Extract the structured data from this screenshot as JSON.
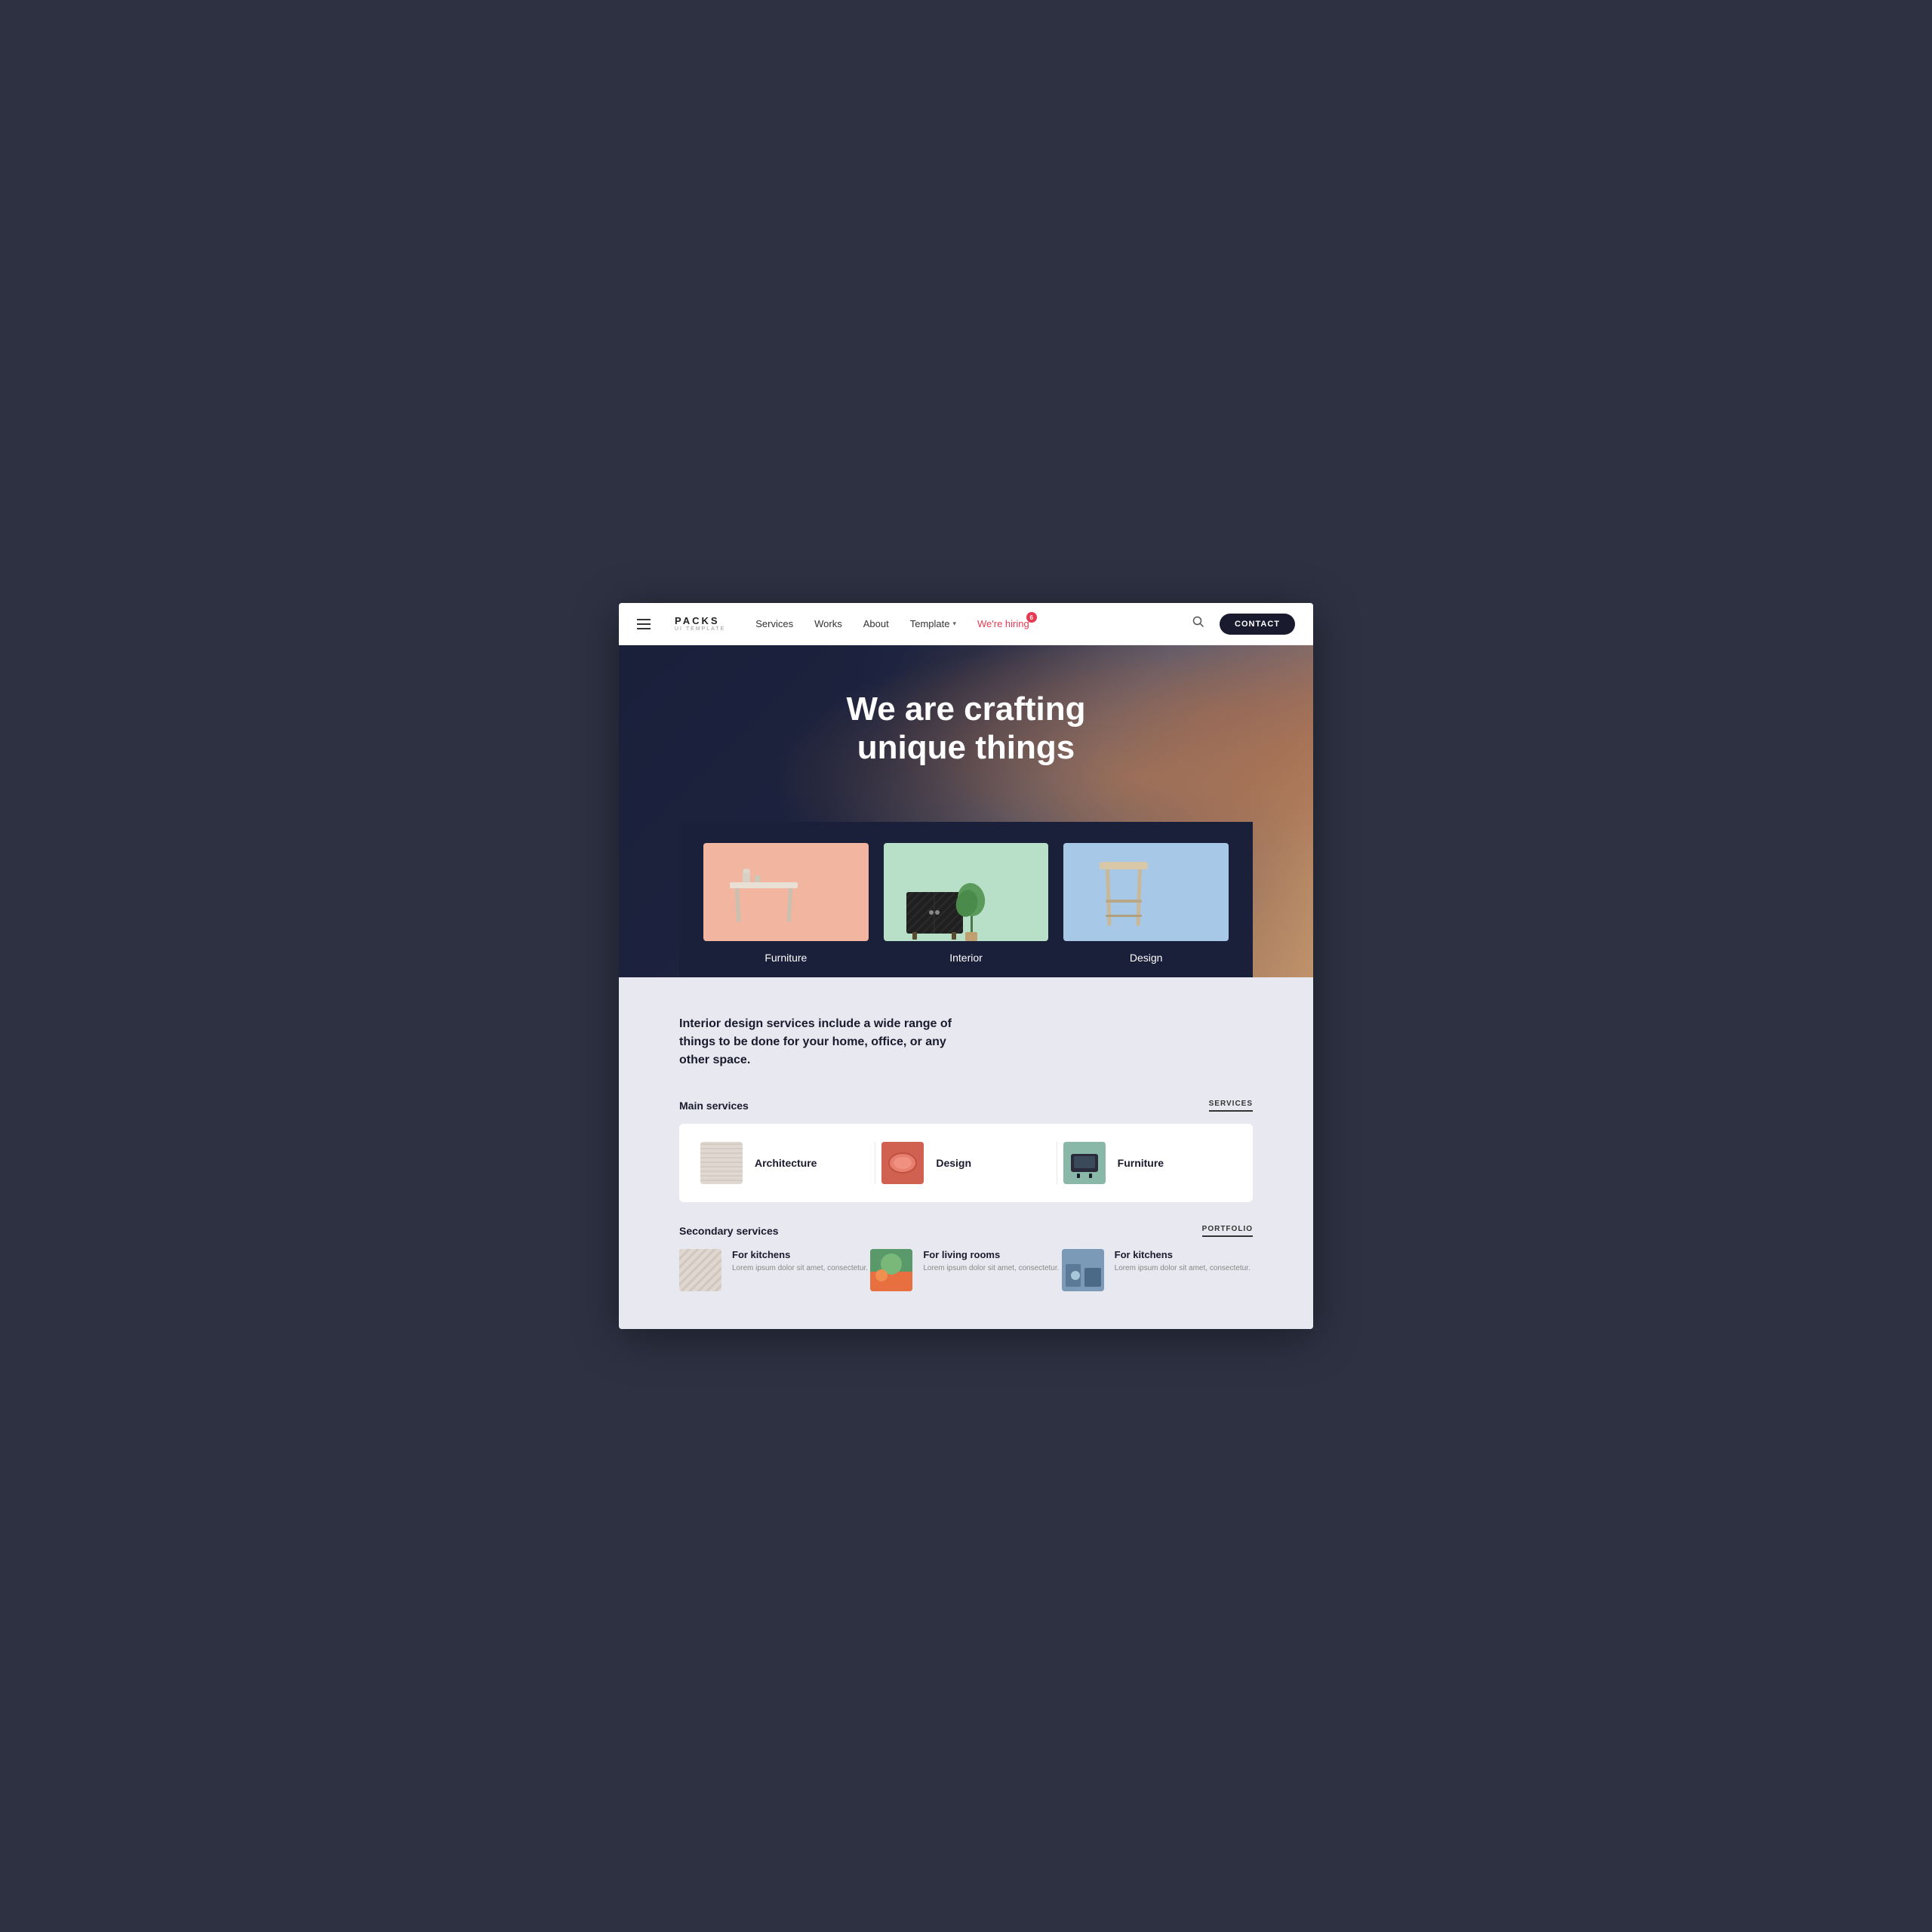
{
  "page": {
    "title": "PACKS UI Template"
  },
  "navbar": {
    "logo_top": "PACKS",
    "logo_sub": "UI TEMPLATE",
    "links": [
      {
        "label": "Services",
        "id": "services"
      },
      {
        "label": "Works",
        "id": "works"
      },
      {
        "label": "About",
        "id": "about"
      },
      {
        "label": "Template",
        "id": "template",
        "hasDropdown": true
      },
      {
        "label": "We're hiring",
        "id": "hiring",
        "accent": true,
        "badge": "6"
      }
    ],
    "contact_label": "CONTACT"
  },
  "hero": {
    "title_line1": "We are crafting",
    "title_line2": "unique things",
    "cards": [
      {
        "label": "Furniture",
        "id": "furniture"
      },
      {
        "label": "Interior",
        "id": "interior"
      },
      {
        "label": "Design",
        "id": "design"
      }
    ]
  },
  "services": {
    "description": "Interior design services include a wide range of things to be done for your home, office, or any other space.",
    "main_label": "Main services",
    "main_tag": "SERVICES",
    "items": [
      {
        "name": "Architecture",
        "id": "architecture"
      },
      {
        "name": "Design",
        "id": "design"
      },
      {
        "name": "Furniture",
        "id": "furniture"
      }
    ],
    "secondary_label": "Secondary services",
    "secondary_tag": "PORTFOLIO",
    "secondary_items": [
      {
        "title": "For kitchens",
        "desc": "Lorem ipsum dolor sit amet, consectetur.",
        "id": "kitchen1"
      },
      {
        "title": "For living rooms",
        "desc": "Lorem ipsum dolor sit amet, consectetur.",
        "id": "living"
      },
      {
        "title": "For kitchens",
        "desc": "Lorem ipsum dolor sit amet, consectetur.",
        "id": "kitchen2"
      }
    ]
  }
}
